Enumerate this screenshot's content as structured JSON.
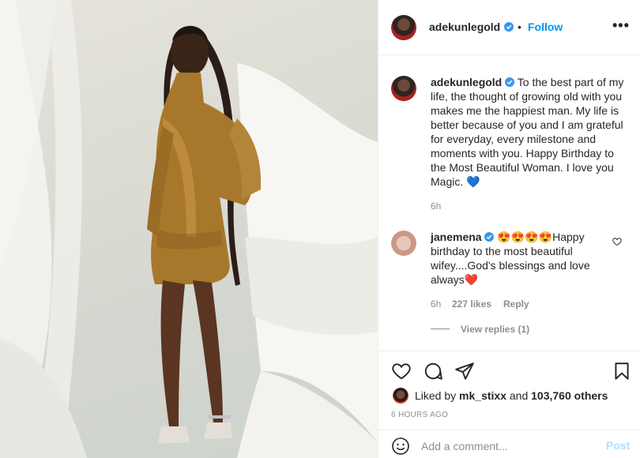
{
  "header": {
    "username": "adekunlegold",
    "separator": "•",
    "follow_label": "Follow",
    "more_label": "•••"
  },
  "caption": {
    "username": "adekunlegold",
    "text": "To the best part of my life, the thought of growing old with you makes me the happiest man. My life is better because of you and I am grateful for everyday, every milestone and moments with you. Happy Birthday to the Most Beautiful Woman. I love you Magic. 💙",
    "time": "6h"
  },
  "comment": {
    "username": "janemena",
    "text": "😍😍😍😍Happy birthday to the most beautiful wifey....God's blessings and love always❤️",
    "time": "6h",
    "likes": "227 likes",
    "reply_label": "Reply",
    "view_replies": "View replies (1)"
  },
  "actions": {
    "icons": [
      "heart-icon",
      "comment-icon",
      "share-icon",
      "bookmark-icon"
    ]
  },
  "likes": {
    "prefix": "Liked by",
    "user": "mk_stixx",
    "joiner": "and",
    "others": "103,760 others"
  },
  "posted_ago": "6 HOURS AGO",
  "add_comment": {
    "placeholder": "Add a comment...",
    "post_label": "Post"
  },
  "colors": {
    "accent": "#0095f6",
    "post_disabled": "#b2dffc",
    "muted": "#8e8e8e",
    "dress": "#a7782c"
  }
}
